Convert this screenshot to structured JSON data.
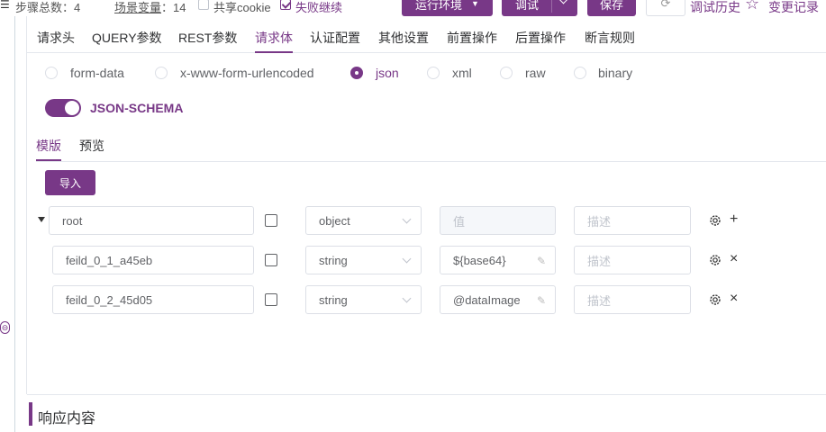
{
  "topbar": {
    "menu_glyph": "☰",
    "steps_text": "步骤总数：4",
    "vars_label": "场景变量",
    "vars_count": "：14",
    "share_cookie": "共享cookie",
    "continue_on_fail": "失败继续",
    "env_button": "运行环境",
    "debug_button": "调试",
    "save_button": "保存",
    "history_link": "调试历史",
    "changes_link": "变更记录"
  },
  "tabs": [
    "请求头",
    "QUERY参数",
    "REST参数",
    "请求体",
    "认证配置",
    "其他设置",
    "前置操作",
    "后置操作",
    "断言规则"
  ],
  "active_tab": "请求体",
  "body_types": [
    "form-data",
    "x-www-form-urlencoded",
    "json",
    "xml",
    "raw",
    "binary"
  ],
  "selected_body_type": "json",
  "json_schema_label": "JSON-SCHEMA",
  "json_schema_enabled": true,
  "subtabs": [
    "模版",
    "预览"
  ],
  "import_button": "导入",
  "schema_rows": [
    {
      "name": "root",
      "type": "object",
      "value": "",
      "value_placeholder": "值",
      "desc_placeholder": "描述",
      "action": "+"
    },
    {
      "name": "feild_0_1_a45eb",
      "type": "string",
      "value": "${base64}",
      "value_placeholder": "",
      "desc_placeholder": "描述",
      "action": "×"
    },
    {
      "name": "feild_0_2_45d05",
      "type": "string",
      "value": "@dataImage",
      "value_placeholder": "",
      "desc_placeholder": "描述",
      "action": "×"
    }
  ],
  "response_title": "响应内容",
  "colors": {
    "accent": "#783887",
    "border": "#dcdfe6",
    "text": "#303133"
  }
}
